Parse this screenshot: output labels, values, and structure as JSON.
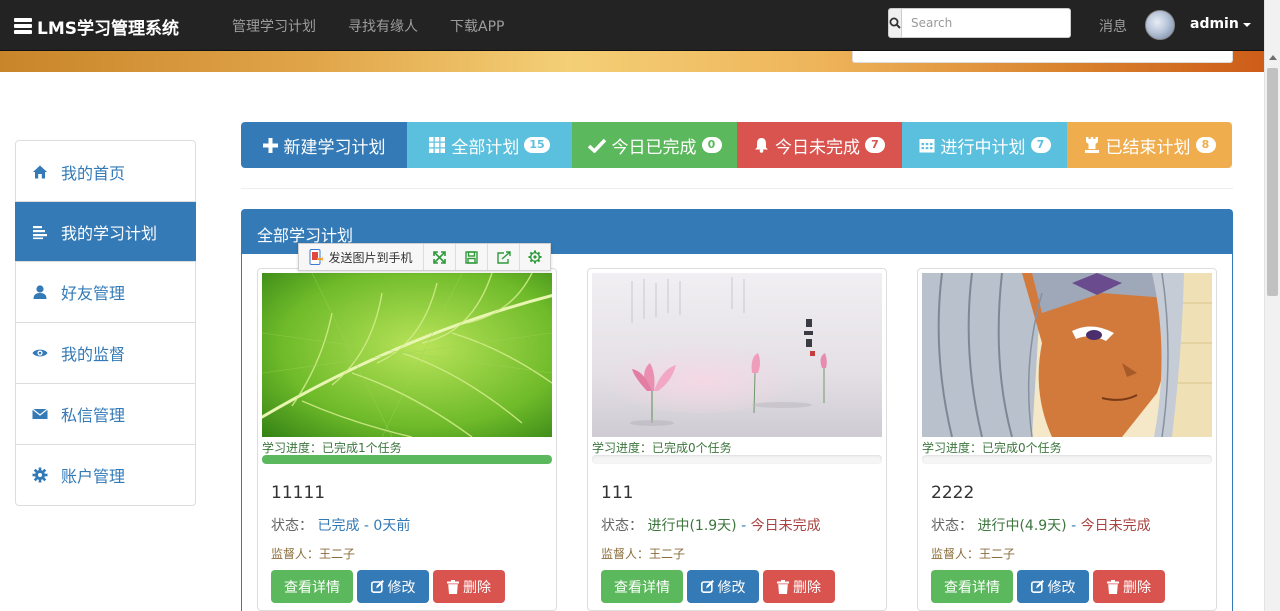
{
  "navbar": {
    "brand": "LMS学习管理系统",
    "links": [
      "管理学习计划",
      "寻找有缘人",
      "下载APP"
    ],
    "search_placeholder": "Search",
    "messages": "消息",
    "user": "admin"
  },
  "sidebar": {
    "items": [
      {
        "label": "我的首页",
        "icon": "home-icon"
      },
      {
        "label": "我的学习计划",
        "icon": "list-icon",
        "active": true
      },
      {
        "label": "好友管理",
        "icon": "user-icon"
      },
      {
        "label": "我的监督",
        "icon": "eye-icon"
      },
      {
        "label": "私信管理",
        "icon": "envelope-icon"
      },
      {
        "label": "账户管理",
        "icon": "gear-icon"
      }
    ]
  },
  "filters": [
    {
      "label": "新建学习计划",
      "icon": "plus-icon",
      "color": "#337ab7"
    },
    {
      "label": "全部计划",
      "icon": "grid-icon",
      "badge": "15",
      "color": "#5bc0de"
    },
    {
      "label": "今日已完成",
      "icon": "check-icon",
      "badge": "0",
      "color": "#5cb85c"
    },
    {
      "label": "今日未完成",
      "icon": "bell-icon",
      "badge": "7",
      "color": "#d9534f"
    },
    {
      "label": "进行中计划",
      "icon": "calendar-icon",
      "badge": "7",
      "color": "#5bc0de"
    },
    {
      "label": "已结束计划",
      "icon": "tower-icon",
      "badge": "8",
      "color": "#f0ad4e"
    }
  ],
  "panel": {
    "title": "全部学习计划"
  },
  "image_toolbar": {
    "send_label": "发送图片到手机"
  },
  "cards": [
    {
      "image": "green-leaf",
      "progress_label": "学习进度：已完成1个任务",
      "progress": 1.0,
      "title": "11111",
      "status_label": "状态：",
      "status_value": "已完成",
      "status_sep": " - ",
      "status_tail": "0天前",
      "supervisor": "监督人：王二子"
    },
    {
      "image": "lotus-painting",
      "progress_label": "学习进度：已完成0个任务",
      "progress": 0.0,
      "title": "111",
      "status_label": "状态：",
      "status_value": "进行中(1.9天)",
      "status_sep": " - ",
      "status_tail": "今日未完成",
      "supervisor": "监督人：王二子"
    },
    {
      "image": "anime-character",
      "progress_label": "学习进度：已完成0个任务",
      "progress": 0.0,
      "title": "2222",
      "status_label": "状态：",
      "status_value": "进行中(4.9天)",
      "status_sep": " - ",
      "status_tail": "今日未完成",
      "supervisor": "监督人：王二子"
    }
  ],
  "card_actions": {
    "detail": "查看详情",
    "edit": "修改",
    "delete": "删除"
  },
  "colors": {
    "primary": "#337ab7",
    "success": "#5cb85c",
    "info": "#5bc0de",
    "danger": "#d9534f",
    "warning": "#f0ad4e",
    "navbar": "#232323"
  }
}
